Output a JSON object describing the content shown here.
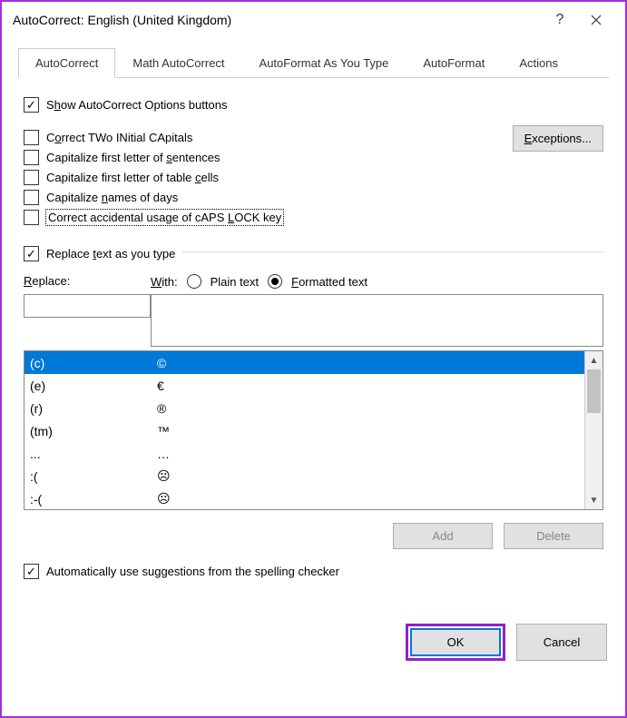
{
  "title": "AutoCorrect: English (United Kingdom)",
  "tabs": [
    "AutoCorrect",
    "Math AutoCorrect",
    "AutoFormat As You Type",
    "AutoFormat",
    "Actions"
  ],
  "active_tab": 0,
  "show_options_label": "Show AutoCorrect Options buttons",
  "options": [
    {
      "label": "Correct TWo INitial CApitals",
      "checked": false
    },
    {
      "label": "Capitalize first letter of sentences",
      "checked": false
    },
    {
      "label": "Capitalize first letter of table cells",
      "checked": false
    },
    {
      "label": "Capitalize names of days",
      "checked": false
    },
    {
      "label": "Correct accidental usage of cAPS LOCK key",
      "checked": false
    }
  ],
  "exceptions_label": "Exceptions...",
  "replace_as_type_label": "Replace text as you type",
  "replace_label": "Replace:",
  "with_label": "With:",
  "radio_plain": "Plain text",
  "radio_formatted": "Formatted text",
  "radio_selected": "formatted",
  "entries": [
    {
      "from": "(c)",
      "to": "©"
    },
    {
      "from": "(e)",
      "to": "€"
    },
    {
      "from": "(r)",
      "to": "®"
    },
    {
      "from": "(tm)",
      "to": "™"
    },
    {
      "from": "...",
      "to": "…"
    },
    {
      "from": ":(",
      "to": "☹"
    },
    {
      "from": ":-(",
      "to": "☹"
    }
  ],
  "selected_entry": 0,
  "add_label": "Add",
  "delete_label": "Delete",
  "auto_spell_label": "Automatically use suggestions from the spelling checker",
  "ok_label": "OK",
  "cancel_label": "Cancel"
}
